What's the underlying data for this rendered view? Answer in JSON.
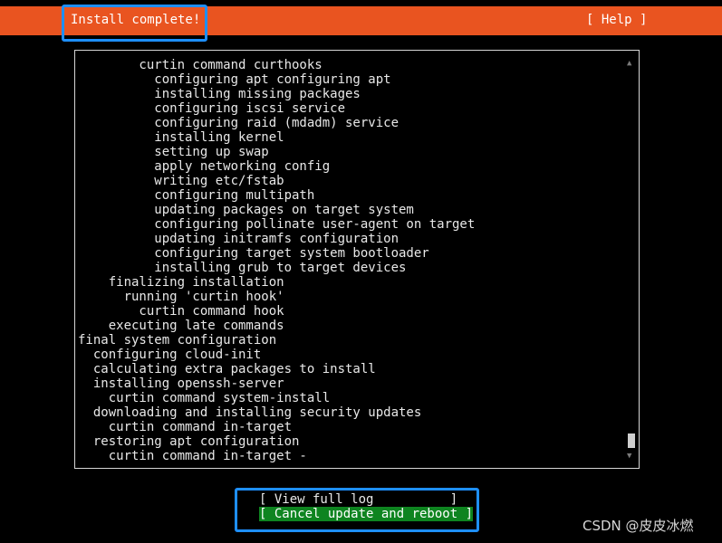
{
  "header": {
    "title": "Install complete!",
    "help_label": "[ Help ]"
  },
  "log": {
    "lines": [
      "        curtin command curthooks",
      "          configuring apt configuring apt",
      "          installing missing packages",
      "          configuring iscsi service",
      "          configuring raid (mdadm) service",
      "          installing kernel",
      "          setting up swap",
      "          apply networking config",
      "          writing etc/fstab",
      "          configuring multipath",
      "          updating packages on target system",
      "          configuring pollinate user-agent on target",
      "          updating initramfs configuration",
      "          configuring target system bootloader",
      "          installing grub to target devices",
      "    finalizing installation",
      "      running 'curtin hook'",
      "        curtin command hook",
      "    executing late commands",
      "final system configuration",
      "  configuring cloud-init",
      "  calculating extra packages to install",
      "  installing openssh-server",
      "    curtin command system-install",
      "  downloading and installing security updates",
      "    curtin command in-target",
      "  restoring apt configuration",
      "    curtin command in-target -"
    ],
    "scroll_up_icon": "▲",
    "scroll_down_icon": "▼"
  },
  "buttons": {
    "view_log_label": "[ View full log          ]",
    "cancel_label": "[ Cancel update and reboot ]"
  },
  "watermark": "CSDN @皮皮冰燃",
  "colors": {
    "header_bg": "#e95420",
    "selected_button_bg": "#0e8420",
    "highlight_border": "#1e8fff"
  }
}
